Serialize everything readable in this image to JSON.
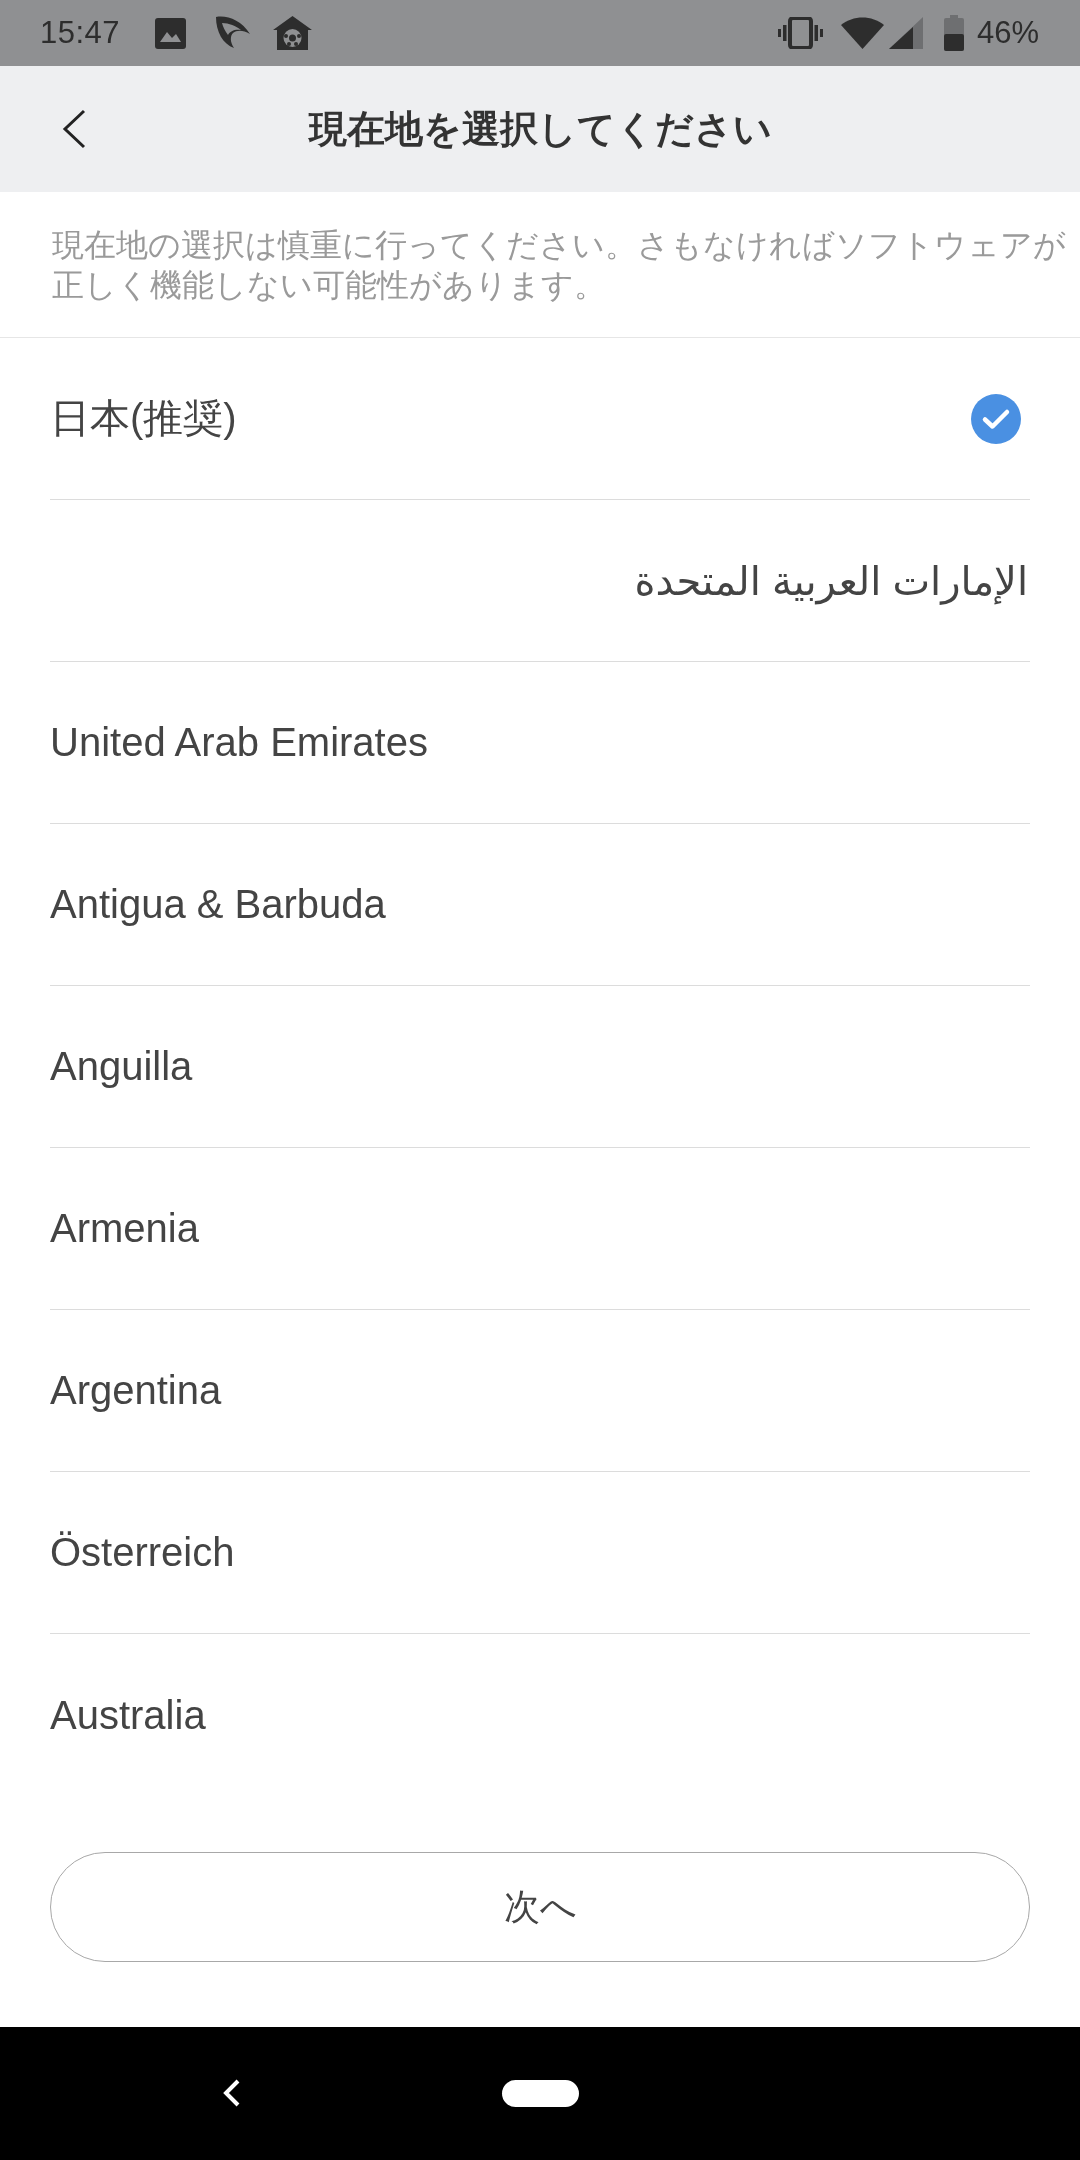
{
  "status_bar": {
    "time": "15:47",
    "battery": "46%"
  },
  "header": {
    "title": "現在地を選択してください"
  },
  "notice": "現在地の選択は慎重に行ってください。さもなければソフトウェアが正しく機能しない可能性があります。",
  "regions": [
    {
      "name": "日本(推奨)",
      "selected": true
    },
    {
      "name": "الإمارات العربية المتحدة",
      "selected": false
    },
    {
      "name": "United Arab Emirates",
      "selected": false
    },
    {
      "name": "Antigua & Barbuda",
      "selected": false
    },
    {
      "name": "Anguilla",
      "selected": false
    },
    {
      "name": "Armenia",
      "selected": false
    },
    {
      "name": "Argentina",
      "selected": false
    },
    {
      "name": "Österreich",
      "selected": false
    },
    {
      "name": "Australia",
      "selected": false
    }
  ],
  "next_button": {
    "label": "次へ"
  }
}
